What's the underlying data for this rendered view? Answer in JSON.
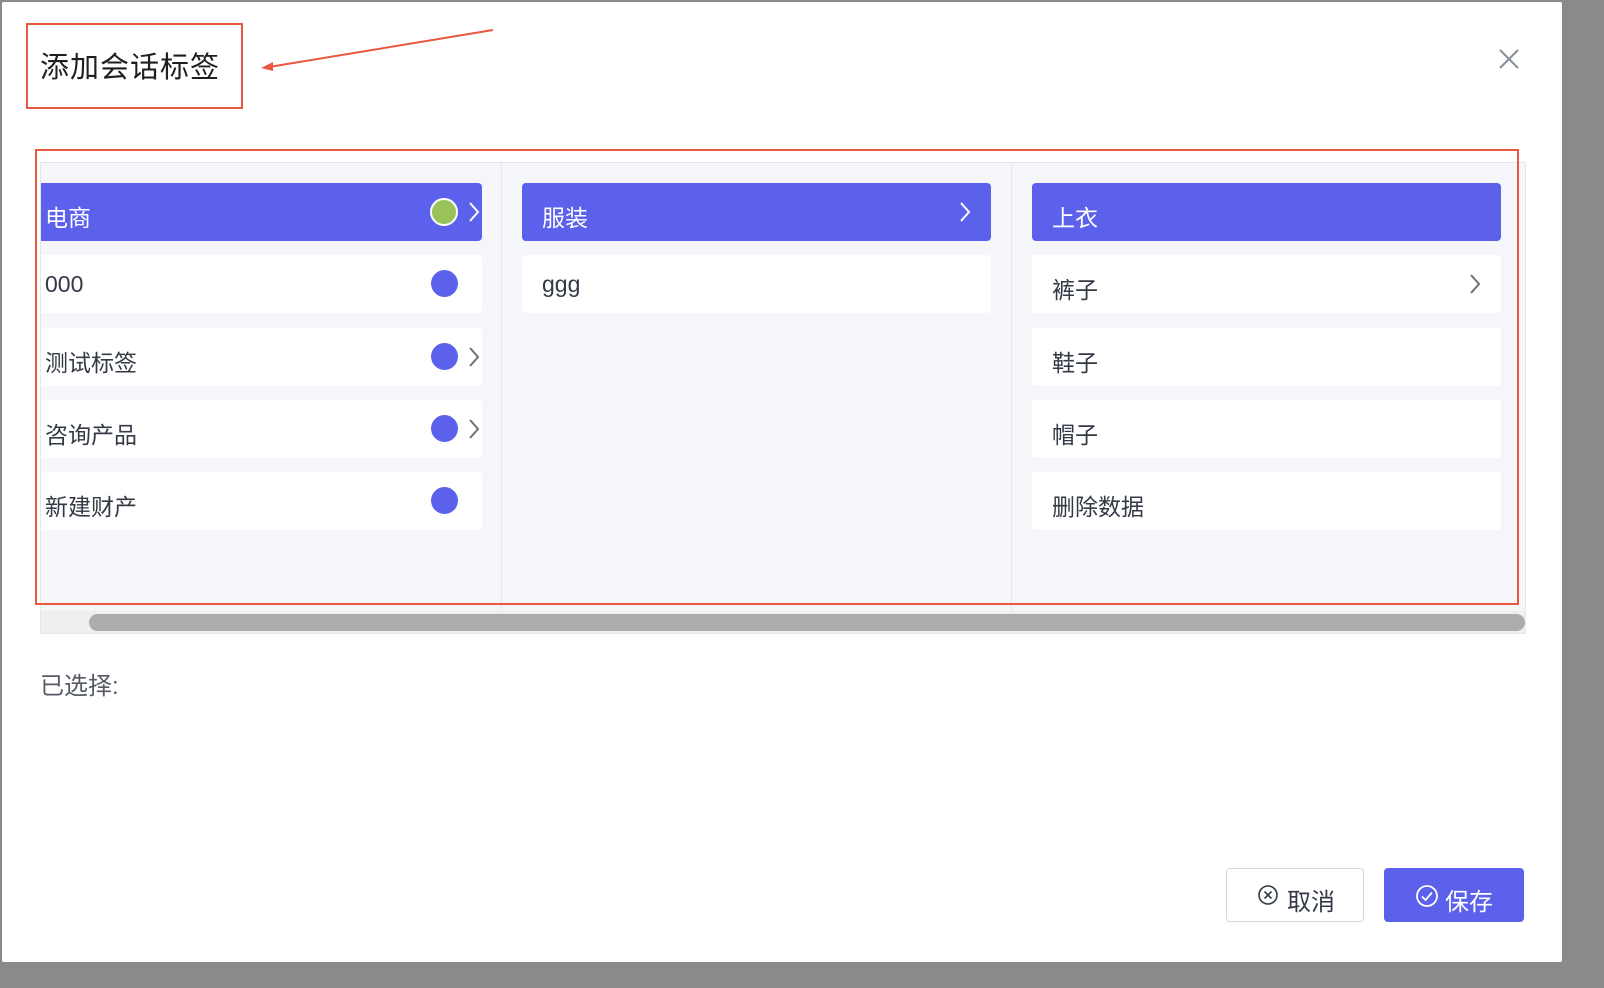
{
  "dialog": {
    "title": "添加会话标签",
    "selected_label": "已选择:",
    "cancel_label": "取消",
    "save_label": "保存"
  },
  "columns": [
    {
      "items": [
        {
          "label": "电商",
          "active": true,
          "dot": "green",
          "has_children": true
        },
        {
          "label": "000",
          "active": false,
          "dot": "blue",
          "has_children": false
        },
        {
          "label": "测试标签",
          "active": false,
          "dot": "blue",
          "has_children": true
        },
        {
          "label": "咨询产品",
          "active": false,
          "dot": "blue",
          "has_children": true
        },
        {
          "label": "新建财产",
          "active": false,
          "dot": "blue",
          "has_children": false
        }
      ]
    },
    {
      "items": [
        {
          "label": "服装",
          "active": true,
          "has_children": true
        },
        {
          "label": "ggg",
          "active": false,
          "has_children": false
        }
      ]
    },
    {
      "items": [
        {
          "label": "上衣",
          "active": true,
          "has_children": false
        },
        {
          "label": "裤子",
          "active": false,
          "has_children": true
        },
        {
          "label": "鞋子",
          "active": false,
          "has_children": false
        },
        {
          "label": "帽子",
          "active": false,
          "has_children": false
        },
        {
          "label": "删除数据",
          "active": false,
          "has_children": false
        }
      ]
    }
  ],
  "colors": {
    "accent": "#5b61ea",
    "green_dot": "#9ac25a",
    "annotation_red": "#e8573f"
  },
  "icons": {
    "close": "close-icon",
    "chevron": "chevron-right-icon",
    "cancel": "circle-x-icon",
    "save": "circle-check-icon",
    "arrow": "annotation-arrow-icon"
  }
}
